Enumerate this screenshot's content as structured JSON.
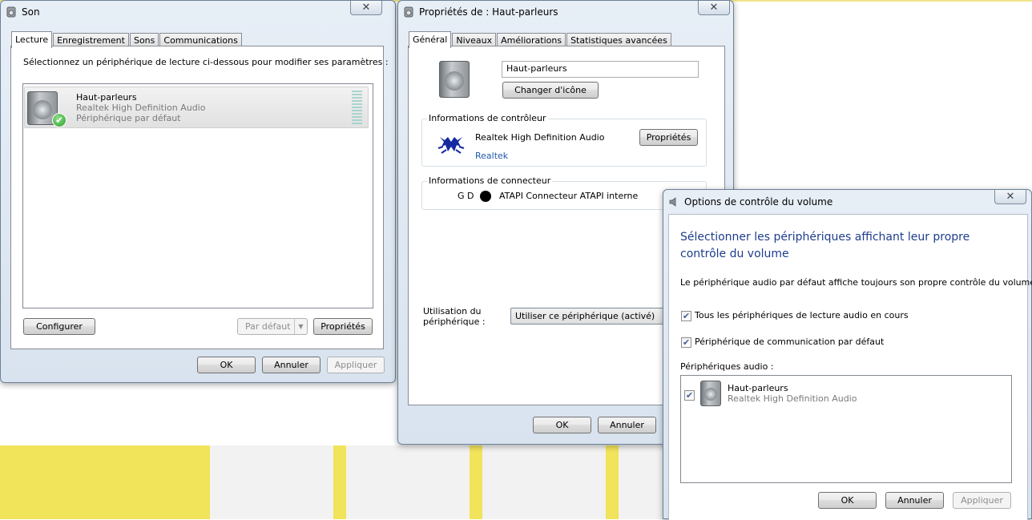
{
  "son_window": {
    "title": "Son",
    "close": "✕",
    "tabs": [
      "Lecture",
      "Enregistrement",
      "Sons",
      "Communications"
    ],
    "instruction": "Sélectionnez un périphérique de lecture ci-dessous pour modifier ses paramètres :",
    "device": {
      "name": "Haut-parleurs",
      "driver": "Realtek High Definition Audio",
      "status": "Périphérique par défaut"
    },
    "buttons": {
      "configure": "Configurer",
      "default": "Par défaut",
      "properties": "Propriétés",
      "ok": "OK",
      "cancel": "Annuler",
      "apply": "Appliquer"
    }
  },
  "props_window": {
    "title": "Propriétés de : Haut-parleurs",
    "close": "✕",
    "tabs": [
      "Général",
      "Niveaux",
      "Améliorations",
      "Statistiques avancées"
    ],
    "name_value": "Haut-parleurs",
    "change_icon": "Changer d'icône",
    "controller": {
      "legend": "Informations de contrôleur",
      "name": "Realtek High Definition Audio",
      "vendor": "Realtek",
      "properties_button": "Propriétés"
    },
    "connector": {
      "legend": "Informations de connecteur",
      "position": "G D",
      "name": "ATAPI Connecteur ATAPI interne"
    },
    "usage_label": "Utilisation du périphérique :",
    "usage_value": "Utiliser ce périphérique (activé)",
    "buttons": {
      "ok": "OK",
      "cancel": "Annuler"
    }
  },
  "volume_window": {
    "title": "Options de contrôle du volume",
    "close": "✕",
    "heading": "Sélectionner les périphériques affichant leur propre contrôle du volume",
    "description": "Le périphérique audio par défaut affiche toujours son propre contrôle du volume.",
    "option_all_playback": "Tous les périphériques de lecture audio en cours",
    "option_default_comm": "Périphérique de communication par défaut",
    "devices_label": "Périphériques audio :",
    "device": {
      "name": "Haut-parleurs",
      "driver": "Realtek High Definition Audio"
    },
    "buttons": {
      "ok": "OK",
      "cancel": "Annuler",
      "apply": "Appliquer"
    }
  },
  "colors": {
    "desktop_yellow": "#f1e35a",
    "desktop_light": "#f2f2f2",
    "heading_blue": "#1e3d8c",
    "realtek_blue": "#1f5aa9"
  }
}
